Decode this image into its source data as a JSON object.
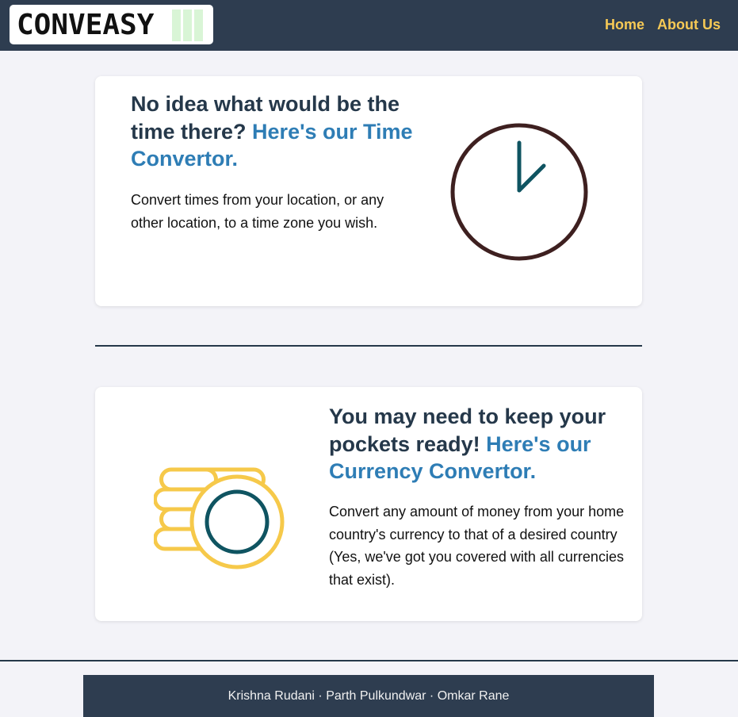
{
  "navbar": {
    "logo_text": "CONVEASY",
    "links": [
      {
        "label": "Home"
      },
      {
        "label": "About Us"
      }
    ]
  },
  "time_section": {
    "heading_plain": "No idea what would be the time there? ",
    "heading_accent": "Here's our Time Convertor.",
    "description": "Convert times from your location, or any other location, to a time zone you wish.",
    "illustration": "clock-icon"
  },
  "currency_section": {
    "heading_plain": "You may need to keep your pockets ready! ",
    "heading_accent": "Here's our Currency Convertor.",
    "description": "Convert any amount of money from your home country's currency to that of a desired country (Yes, we've got you covered with all currencies that exist).",
    "illustration": "coins-icon"
  },
  "footer": {
    "credits": "Krishna Rudani · Parth Pulkundwar · Omkar Rane"
  },
  "colors": {
    "navbar_bg": "#2e3d50",
    "nav_link": "#f6c955",
    "heading": "#25384a",
    "accent": "#2e7db5",
    "background": "#f3f3f8",
    "clock_ring": "#3e2020",
    "clock_hands": "#0f5461",
    "coin_outline": "#f6c94a",
    "coin_inner": "#0f5461",
    "logo_bars": "#d9f5d6"
  }
}
